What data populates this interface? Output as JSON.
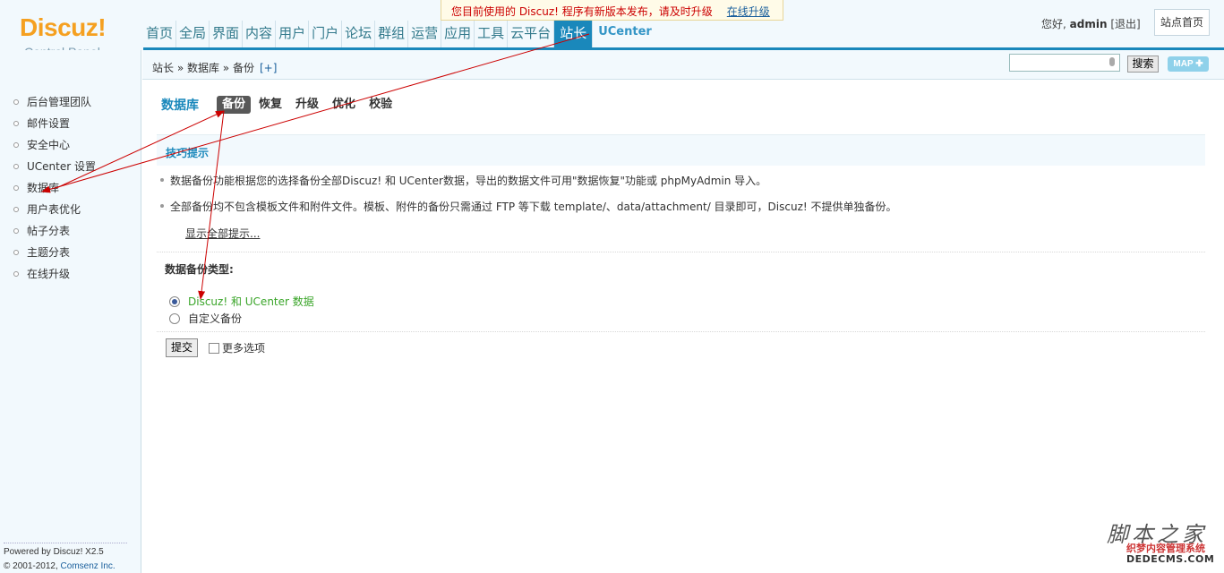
{
  "header": {
    "logo": {
      "main": "Discuz!",
      "sub": "Control Panel"
    },
    "notice": {
      "text": "您目前使用的 Discuz! 程序有新版本发布，请及时升级",
      "link": "在线升级"
    },
    "nav": [
      "首页",
      "全局",
      "界面",
      "内容",
      "用户",
      "门户",
      "论坛",
      "群组",
      "运营",
      "应用",
      "工具",
      "云平台",
      "站长",
      "UCenter"
    ],
    "nav_active": "站长",
    "user": {
      "greeting": "您好,",
      "name": "admin",
      "logout": "[退出]"
    },
    "site_home": "站点首页"
  },
  "breadcrumb": {
    "path": "站长 » 数据库 » 备份",
    "add": "[+]"
  },
  "search": {
    "value": "",
    "button": "搜索",
    "map": "MAP ✚"
  },
  "sidebar": {
    "items": [
      "后台管理团队",
      "邮件设置",
      "安全中心",
      "UCenter 设置",
      "数据库",
      "用户表优化",
      "帖子分表",
      "主题分表",
      "在线升级"
    ],
    "footer": {
      "powered": "Powered by Discuz! X2.5",
      "copyright_prefix": "© 2001-2012,",
      "company": "Comsenz Inc."
    }
  },
  "main": {
    "title": "数据库",
    "tabs": [
      "备份",
      "恢复",
      "升级",
      "优化",
      "校验"
    ],
    "tab_current": "备份",
    "tips": {
      "title": "技巧提示",
      "items": [
        "数据备份功能根据您的选择备份全部Discuz! 和 UCenter数据，导出的数据文件可用\"数据恢复\"功能或 phpMyAdmin 导入。",
        "全部备份均不包含模板文件和附件文件。模板、附件的备份只需通过 FTP 等下载 template/、data/attachment/ 目录即可，Discuz! 不提供单独备份。"
      ],
      "show_all": "显示全部提示..."
    },
    "backup_type": {
      "label": "数据备份类型:",
      "options": [
        "Discuz! 和 UCenter 数据",
        "自定义备份"
      ],
      "selected": "Discuz! 和 UCenter 数据"
    },
    "submit": "提交",
    "more_options": "更多选项"
  },
  "watermark": {
    "top": "脚本之家",
    "mid": "织梦内容管理系统",
    "bottom": "DEDECMS.COM"
  },
  "colors": {
    "accent": "#1a88bb",
    "logo": "#f5a020",
    "annotation": "#cc0000",
    "selected_option": "#3aa529"
  }
}
